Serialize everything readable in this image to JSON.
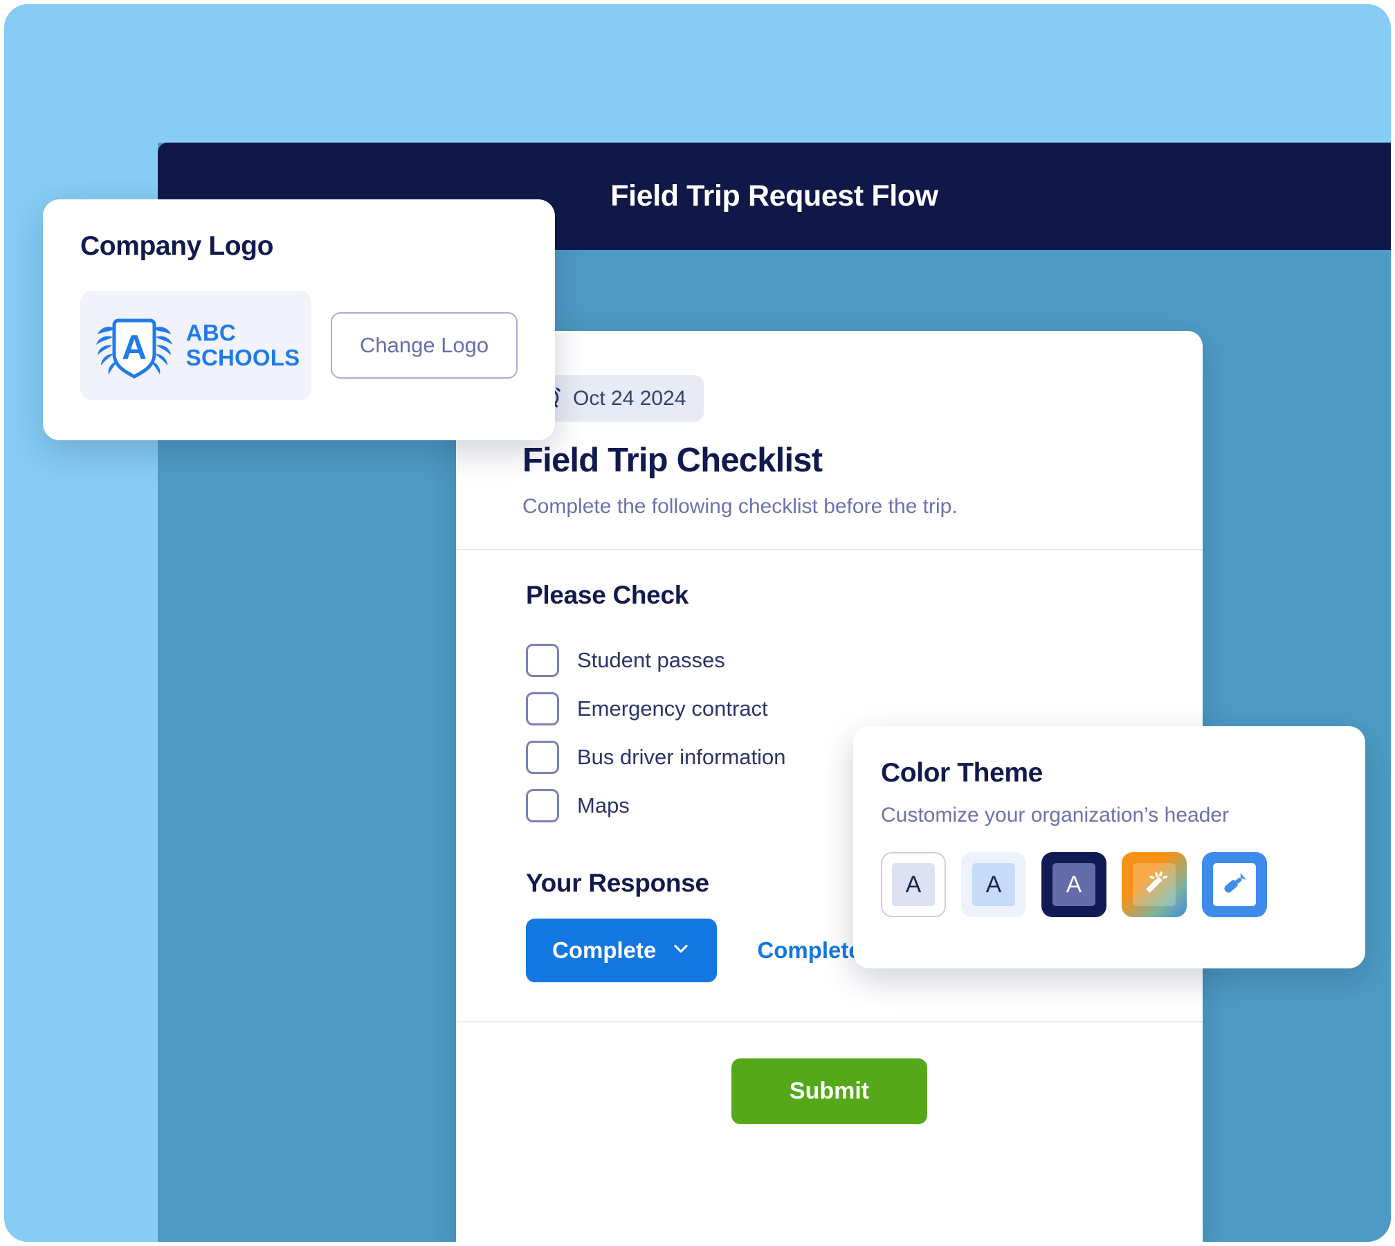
{
  "app": {
    "header_title": "Field Trip Request Flow"
  },
  "logo_card": {
    "heading": "Company Logo",
    "logo_line1": "ABC",
    "logo_line2": "SCHOOLS",
    "logo_letter": "A",
    "change_button_label": "Change Logo",
    "logo_icon": "shield-laurel-icon"
  },
  "form": {
    "date_badge": {
      "icon": "alarm-clock-icon",
      "text": "Oct 24 2024"
    },
    "title": "Field Trip Checklist",
    "subtitle": "Complete the following checklist before the trip.",
    "section_title": "Please Check",
    "checklist": [
      {
        "label": "Student passes",
        "checked": false
      },
      {
        "label": "Emergency contract",
        "checked": false
      },
      {
        "label": "Bus driver information",
        "checked": false
      },
      {
        "label": "Maps",
        "checked": false
      }
    ],
    "response_title": "Your Response",
    "response_button_label": "Complete",
    "response_button_icon": "chevron-down-icon",
    "response_status": "Complete",
    "submit_label": "Submit"
  },
  "theme_card": {
    "heading": "Color Theme",
    "subtitle": "Customize your organization’s header",
    "swatches": [
      {
        "name": "theme-light",
        "letter": "A",
        "icon": ""
      },
      {
        "name": "theme-pale-blue",
        "letter": "A",
        "icon": ""
      },
      {
        "name": "theme-navy",
        "letter": "A",
        "icon": ""
      },
      {
        "name": "theme-gradient",
        "letter": "",
        "icon": "magic-wand-icon"
      },
      {
        "name": "theme-blue-custom",
        "letter": "",
        "icon": "paint-roller-icon"
      }
    ]
  },
  "colors": {
    "backdrop": "#86ccf4",
    "panel": "#4d9bc4",
    "header_navy": "#0f1847",
    "accent_blue": "#1277e0",
    "submit_green": "#55a81a",
    "heading_navy": "#101a4e",
    "muted_slate": "#6b73ab"
  }
}
